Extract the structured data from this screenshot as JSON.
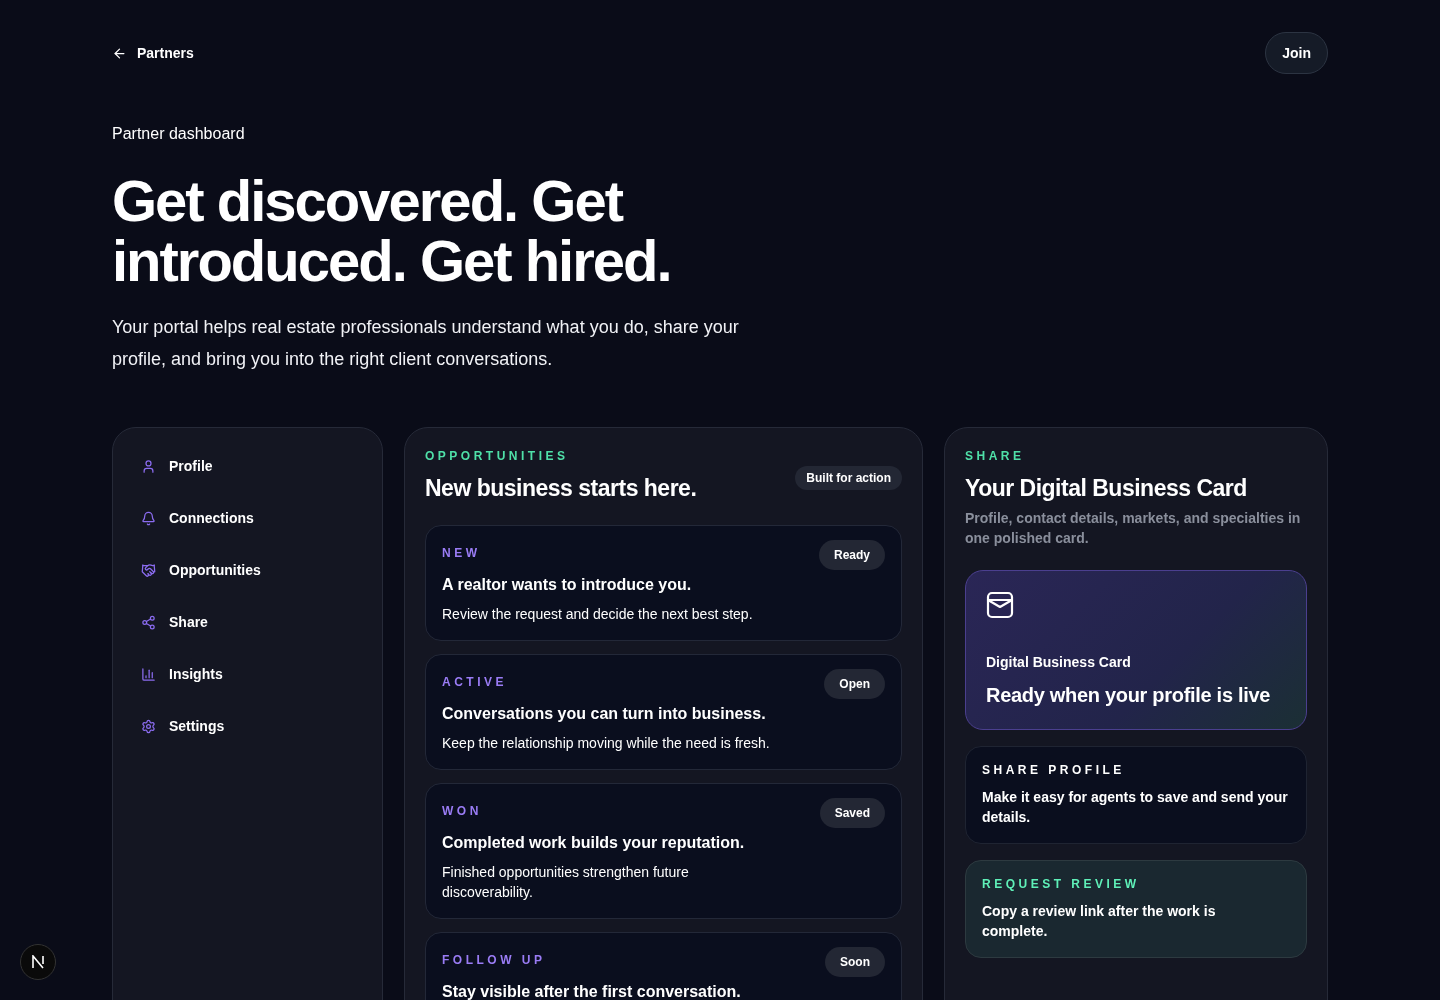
{
  "header": {
    "back_link": "Partners",
    "join_button": "Join"
  },
  "hero": {
    "eyebrow": "Partner dashboard",
    "title": "Get discovered. Get introduced. Get hired.",
    "lead": "Your portal helps real estate professionals understand what you do, share your profile, and bring you into the right client conversations."
  },
  "sidebar": {
    "items": [
      {
        "label": "Profile"
      },
      {
        "label": "Connections"
      },
      {
        "label": "Opportunities"
      },
      {
        "label": "Share"
      },
      {
        "label": "Insights"
      },
      {
        "label": "Settings"
      }
    ]
  },
  "opportunities": {
    "eyebrow": "OPPORTUNITIES",
    "title": "New business starts here.",
    "badge": "Built for action",
    "cards": [
      {
        "tag": "NEW",
        "status": "Ready",
        "title": "A realtor wants to introduce you.",
        "text": "Review the request and decide the next best step."
      },
      {
        "tag": "ACTIVE",
        "status": "Open",
        "title": "Conversations you can turn into business.",
        "text": "Keep the relationship moving while the need is fresh."
      },
      {
        "tag": "WON",
        "status": "Saved",
        "title": "Completed work builds your reputation.",
        "text": "Finished opportunities strengthen future discoverability."
      },
      {
        "tag": "FOLLOW UP",
        "status": "Soon",
        "title": "Stay visible after the first conversation."
      }
    ]
  },
  "share": {
    "eyebrow": "SHARE",
    "title": "Your Digital Business Card",
    "subtitle": "Profile, contact details, markets, and specialties in one polished card.",
    "card": {
      "label": "Digital Business Card",
      "headline": "Ready when your profile is live"
    },
    "actions": [
      {
        "kind": "plain",
        "title": "SHARE PROFILE",
        "text": "Make it easy for agents to save and send your details."
      },
      {
        "kind": "highlight",
        "title": "REQUEST REVIEW",
        "text": "Copy a review link after the work is complete."
      }
    ]
  }
}
